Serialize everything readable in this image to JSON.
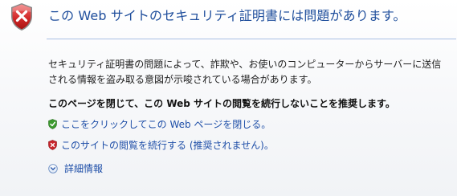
{
  "header": {
    "title": "この Web サイトのセキュリティ証明書には問題があります。",
    "icon": "security-error-shield-icon"
  },
  "message": {
    "text": "セキュリティ証明書の問題によって、詐欺や、お使いのコンピューターからサーバーに送信される情報を盗み取る意図が示唆されている場合があります。",
    "recommendation": "このページを閉じて、この Web サイトの閲覧を続行しないことを推奨します。"
  },
  "actions": {
    "close_label": "ここをクリックしてこの Web ページを閉じる。",
    "close_icon": "green-shield-check-icon",
    "continue_label": "このサイトの閲覧を続行する (推奨されません)。",
    "continue_icon": "red-shield-x-icon",
    "more_info_label": "詳細情報",
    "more_info_icon": "chevron-down-circle-icon"
  },
  "colors": {
    "title": "#1f4e9c",
    "link": "#1f4fa8",
    "error_red": "#c8242b",
    "ok_green": "#3b9a2e"
  }
}
